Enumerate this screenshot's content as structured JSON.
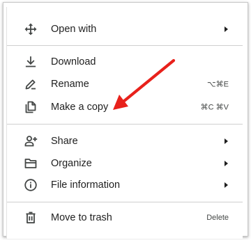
{
  "menu": {
    "items": [
      {
        "label": "Open with",
        "icon": "open-with-icon",
        "shortcut": "",
        "submenu": true
      },
      {
        "label": "Download",
        "icon": "download-icon",
        "shortcut": "",
        "submenu": false
      },
      {
        "label": "Rename",
        "icon": "rename-pencil-icon",
        "shortcut": "⌥⌘E",
        "submenu": false
      },
      {
        "label": "Make a copy",
        "icon": "copy-icon",
        "shortcut": "⌘C ⌘V",
        "submenu": false
      },
      {
        "label": "Share",
        "icon": "share-person-add-icon",
        "shortcut": "",
        "submenu": true
      },
      {
        "label": "Organize",
        "icon": "folder-open-icon",
        "shortcut": "",
        "submenu": true
      },
      {
        "label": "File information",
        "icon": "info-icon",
        "shortcut": "",
        "submenu": true
      },
      {
        "label": "Move to trash",
        "icon": "trash-icon",
        "shortcut": "Delete",
        "submenu": false
      }
    ]
  },
  "annotation": {
    "icon": "red-arrow-icon",
    "color": "#e8211b"
  },
  "colors": {
    "text": "#1f1f1f",
    "shortcut": "#444746",
    "divider": "#cfcfcf"
  }
}
